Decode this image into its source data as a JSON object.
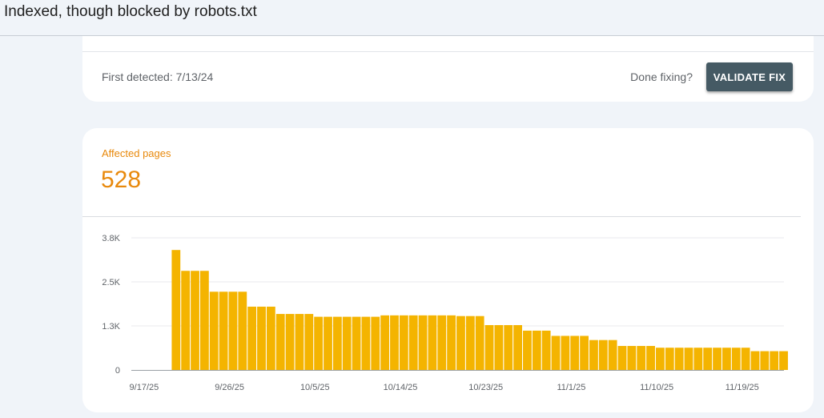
{
  "header": {
    "title": "Indexed, though blocked by robots.txt"
  },
  "status_card": {
    "first_detected": "First detected: 7/13/24",
    "done_fixing": "Done fixing?",
    "validate_label": "VALIDATE FIX"
  },
  "chart_card": {
    "label": "Affected pages",
    "value": "528"
  },
  "colors": {
    "accent": "#e8890c",
    "bar": "#f4b400",
    "button": "#455a64"
  },
  "chart_data": {
    "type": "bar",
    "title": "",
    "xlabel": "",
    "ylabel": "",
    "ylim": [
      0,
      3800
    ],
    "y_ticks": [
      {
        "value": 0,
        "label": "0"
      },
      {
        "value": 1267,
        "label": "1.3K"
      },
      {
        "value": 2533,
        "label": "2.5K"
      },
      {
        "value": 3800,
        "label": "3.8K"
      }
    ],
    "x_tick_labels": [
      "9/17/25",
      "9/26/25",
      "10/5/25",
      "10/14/25",
      "10/23/25",
      "11/1/25",
      "11/10/25",
      "11/19/25"
    ],
    "x_tick_index": [
      0,
      9,
      18,
      27,
      36,
      45,
      54,
      63
    ],
    "grid": true,
    "categories": [
      "9/17/25",
      "9/18/25",
      "9/19/25",
      "9/20/25",
      "9/21/25",
      "9/22/25",
      "9/23/25",
      "9/24/25",
      "9/25/25",
      "9/26/25",
      "9/27/25",
      "9/28/25",
      "9/29/25",
      "9/30/25",
      "10/1/25",
      "10/2/25",
      "10/3/25",
      "10/4/25",
      "10/5/25",
      "10/6/25",
      "10/7/25",
      "10/8/25",
      "10/9/25",
      "10/10/25",
      "10/11/25",
      "10/12/25",
      "10/13/25",
      "10/14/25",
      "10/15/25",
      "10/16/25",
      "10/17/25",
      "10/18/25",
      "10/19/25",
      "10/20/25",
      "10/21/25",
      "10/22/25",
      "10/23/25",
      "10/24/25",
      "10/25/25",
      "10/26/25",
      "10/27/25",
      "10/28/25",
      "10/29/25",
      "10/30/25",
      "10/31/25",
      "11/1/25",
      "11/2/25",
      "11/3/25",
      "11/4/25",
      "11/5/25",
      "11/6/25",
      "11/7/25",
      "11/8/25",
      "11/9/25",
      "11/10/25",
      "11/11/25",
      "11/12/25",
      "11/13/25",
      "11/14/25",
      "11/15/25",
      "11/16/25",
      "11/17/25",
      "11/18/25",
      "11/19/25",
      "11/20/25",
      "11/21/25",
      "11/22/25",
      "11/23/25",
      "11/24/25"
    ],
    "values": [
      null,
      null,
      null,
      null,
      3450,
      2850,
      2850,
      2850,
      2250,
      2250,
      2250,
      2250,
      1820,
      1820,
      1820,
      1610,
      1610,
      1610,
      1610,
      1530,
      1530,
      1530,
      1530,
      1530,
      1530,
      1530,
      1570,
      1570,
      1570,
      1570,
      1570,
      1570,
      1570,
      1570,
      1550,
      1550,
      1550,
      1290,
      1290,
      1290,
      1290,
      1130,
      1130,
      1130,
      980,
      980,
      980,
      980,
      860,
      860,
      860,
      690,
      690,
      690,
      690,
      640,
      640,
      640,
      640,
      640,
      640,
      640,
      640,
      640,
      640,
      540,
      540,
      540,
      540
    ]
  }
}
